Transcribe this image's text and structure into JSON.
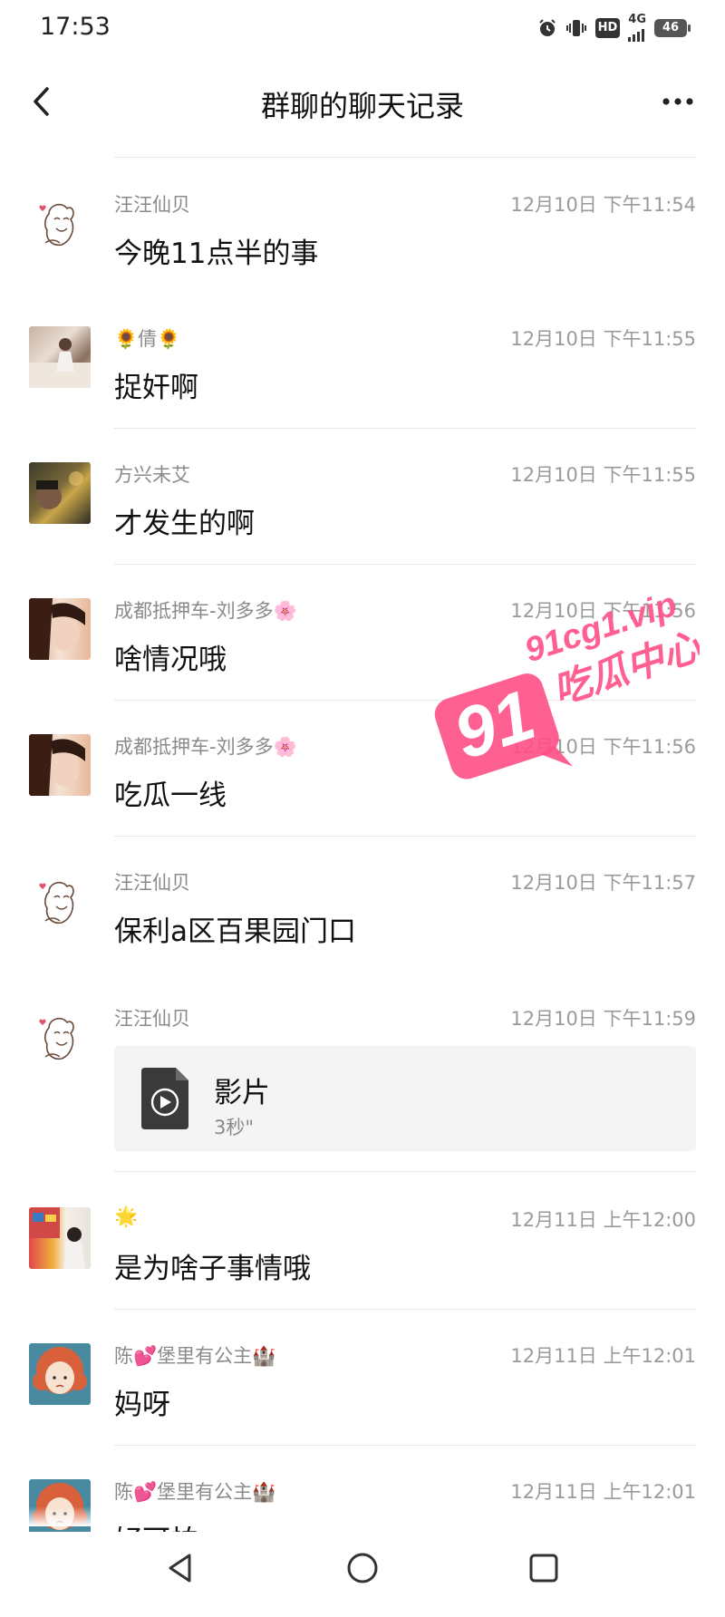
{
  "status_bar": {
    "time": "17:53",
    "hd": "HD",
    "network": "4G",
    "battery": "46"
  },
  "header": {
    "title": "群聊的聊天记录",
    "back_icon": "chevron-left-icon",
    "more_icon": "more-dots-icon"
  },
  "messages": [
    {
      "sender": "汪汪仙贝",
      "time": "12月10日 下午11:54",
      "text": "今晚11点半的事",
      "avatar": "cat-sketch-avatar"
    },
    {
      "sender": "🌻倩🌻",
      "time": "12月10日 下午11:55",
      "text": "捉奸啊",
      "avatar": "photo-avatar"
    },
    {
      "sender": "方兴未艾",
      "time": "12月10日 下午11:55",
      "text": "才发生的啊",
      "avatar": "photo-avatar"
    },
    {
      "sender": "成都抵押车-刘多多🌸",
      "time": "12月10日 下午11:56",
      "text": "啥情况哦",
      "avatar": "photo-avatar"
    },
    {
      "sender": "成都抵押车-刘多多🌸",
      "time": "12月10日 下午11:56",
      "text": "吃瓜一线",
      "avatar": "photo-avatar"
    },
    {
      "sender": "汪汪仙贝",
      "time": "12月10日 下午11:57",
      "text": "保利a区百果园门口",
      "avatar": "cat-sketch-avatar"
    },
    {
      "sender": "汪汪仙贝",
      "time": "12月10日 下午11:59",
      "avatar": "cat-sketch-avatar",
      "video": {
        "title": "影片",
        "duration": "3秒\"",
        "icon": "video-file-icon"
      }
    },
    {
      "sender": "🌟",
      "time": "12月11日 上午12:00",
      "text": "是为啥子事情哦",
      "avatar": "photo-avatar"
    },
    {
      "sender": "陈💕堡里有公主🏰",
      "time": "12月11日 上午12:01",
      "text": "妈呀",
      "avatar": "cartoon-girl-avatar"
    },
    {
      "sender": "陈💕堡里有公主🏰",
      "time": "12月11日 上午12:01",
      "text": "好可怕",
      "avatar": "cartoon-girl-avatar"
    }
  ],
  "watermark": {
    "logo": "91",
    "site": "91cg1.vip",
    "name": "吃瓜中心",
    "color": "#ff3f7a"
  },
  "system_nav": {
    "back_icon": "triangle-back-icon",
    "home_icon": "circle-home-icon",
    "recents_icon": "square-recents-icon"
  }
}
